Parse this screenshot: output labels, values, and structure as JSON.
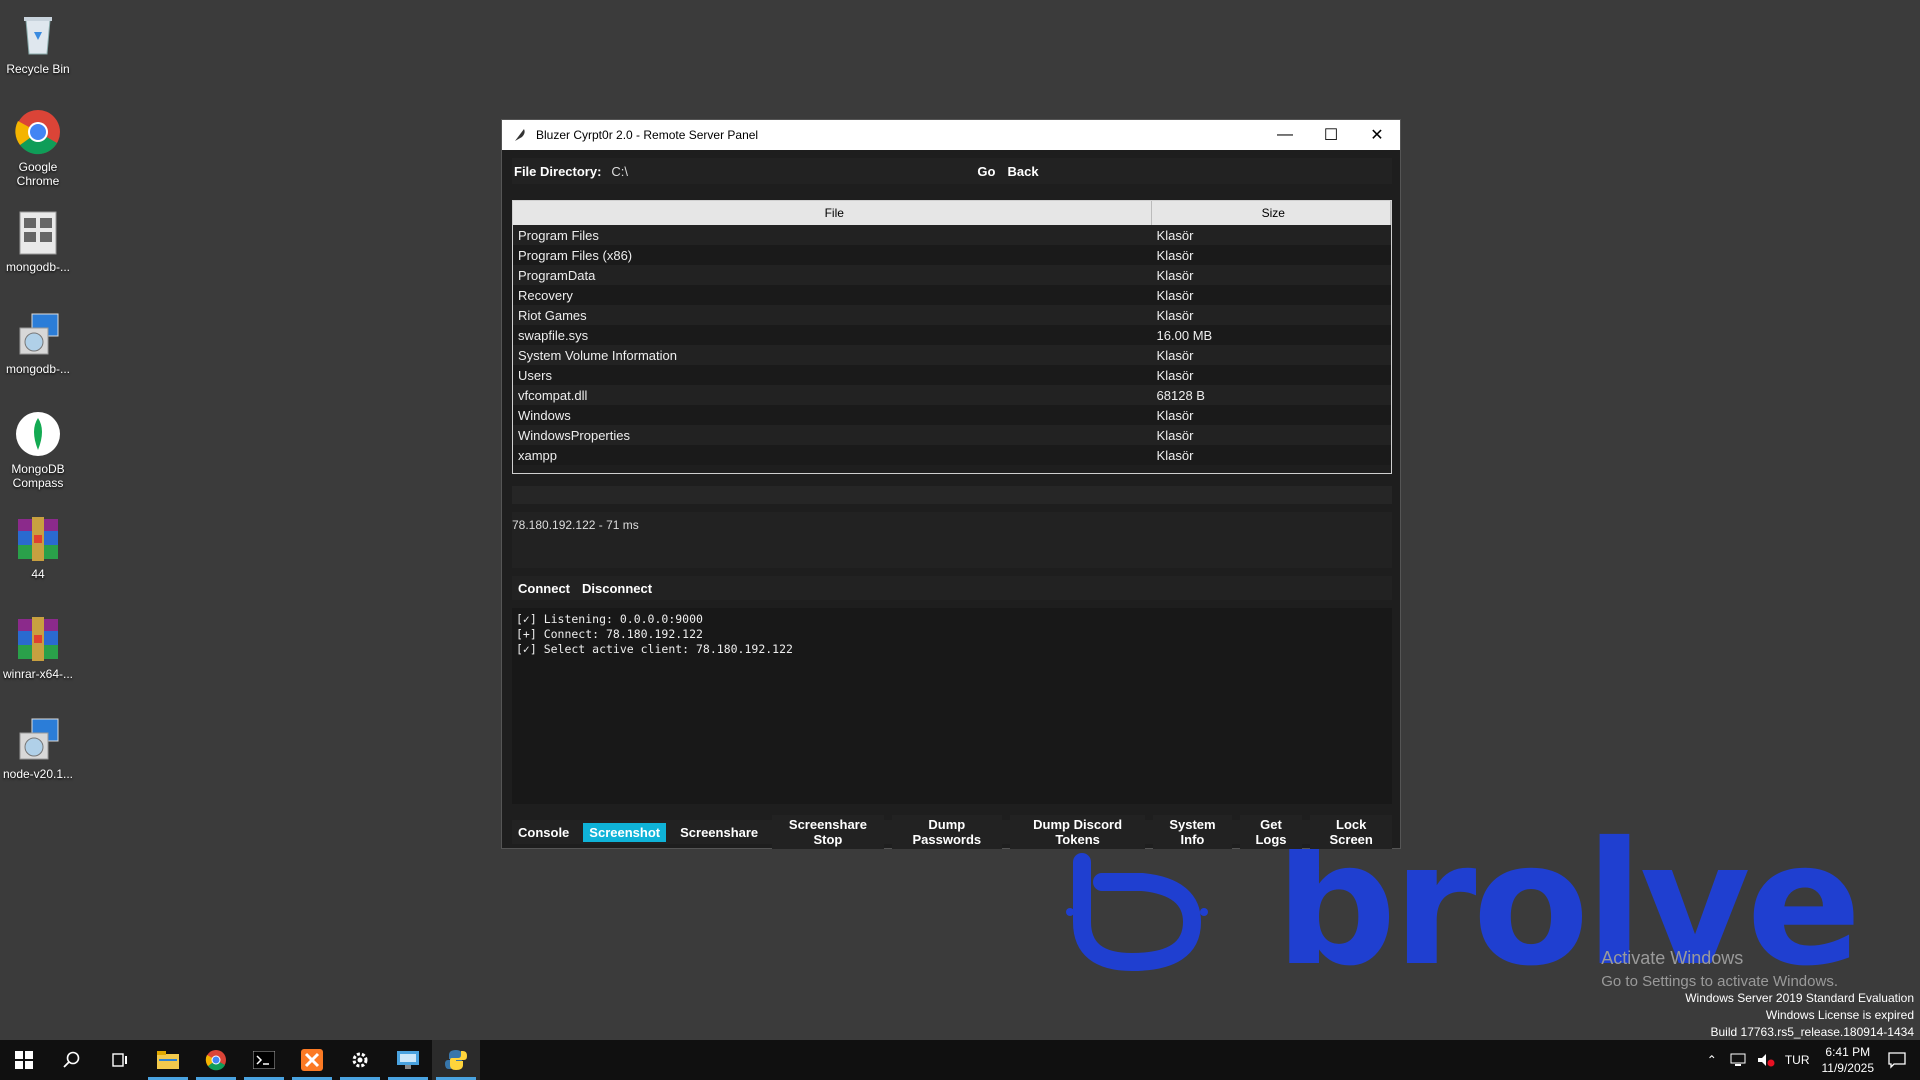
{
  "desktop": {
    "icons": [
      {
        "label": "Recycle Bin",
        "icon": "recycle-bin-icon"
      },
      {
        "label": "Google Chrome",
        "icon": "chrome-icon"
      },
      {
        "label": "mongodb-...",
        "icon": "installer-icon"
      },
      {
        "label": "mongodb-...",
        "icon": "setup-icon"
      },
      {
        "label": "MongoDB Compass",
        "icon": "mongodb-compass-icon"
      },
      {
        "label": "44",
        "icon": "winrar-icon"
      },
      {
        "label": "winrar-x64-...",
        "icon": "winrar-icon"
      },
      {
        "label": "node-v20.1...",
        "icon": "setup-icon"
      }
    ],
    "wallpaper_text": "brolve",
    "activate": {
      "line1": "Activate Windows",
      "line2": "Go to Settings to activate Windows."
    },
    "winver": {
      "line1": "Windows Server 2019 Standard Evaluation",
      "line2": "Windows License is expired",
      "line3": "Build 17763.rs5_release.180914-1434"
    }
  },
  "window": {
    "title": "Bluzer Cyrpt0r 2.0 - Remote Server Panel",
    "dir_label": "File Directory:",
    "dir_value": "C:\\",
    "go_label": "Go",
    "back_label": "Back",
    "columns": {
      "file": "File",
      "size": "Size"
    },
    "files": [
      {
        "name": "Program Files",
        "size": "Klasör"
      },
      {
        "name": "Program Files (x86)",
        "size": "Klasör"
      },
      {
        "name": "ProgramData",
        "size": "Klasör"
      },
      {
        "name": "Recovery",
        "size": "Klasör"
      },
      {
        "name": "Riot Games",
        "size": "Klasör"
      },
      {
        "name": "swapfile.sys",
        "size": "16.00 MB"
      },
      {
        "name": "System Volume Information",
        "size": "Klasör"
      },
      {
        "name": "Users",
        "size": "Klasör"
      },
      {
        "name": "vfcompat.dll",
        "size": "68128 B"
      },
      {
        "name": "Windows",
        "size": "Klasör"
      },
      {
        "name": "WindowsProperties",
        "size": "Klasör"
      },
      {
        "name": "xampp",
        "size": "Klasör"
      }
    ],
    "ping": "78.180.192.122 - 71 ms",
    "connect_label": "Connect",
    "disconnect_label": "Disconnect",
    "console_lines": [
      "[✓] Listening: 0.0.0.0:9000",
      "[+] Connect: 78.180.192.122",
      "[✓] Select active client: 78.180.192.122"
    ],
    "toolbar": [
      "Console",
      "Screenshot",
      "Screenshare",
      "Screenshare Stop",
      "Dump Passwords",
      "Dump Discord Tokens",
      "System Info",
      "Get Logs",
      "Lock Screen"
    ],
    "toolbar_active": "Screenshot",
    "accent_color": "#0fb3d8"
  },
  "taskbar": {
    "items": [
      "start-icon",
      "search-icon",
      "task-view-icon",
      "file-explorer-icon",
      "chrome-icon",
      "terminal-icon",
      "xampp-icon",
      "settings-icon",
      "remote-desktop-icon",
      "python-icon"
    ],
    "tray": {
      "lang": "TUR",
      "time": "6:41 PM",
      "date": "11/9/2025"
    }
  }
}
